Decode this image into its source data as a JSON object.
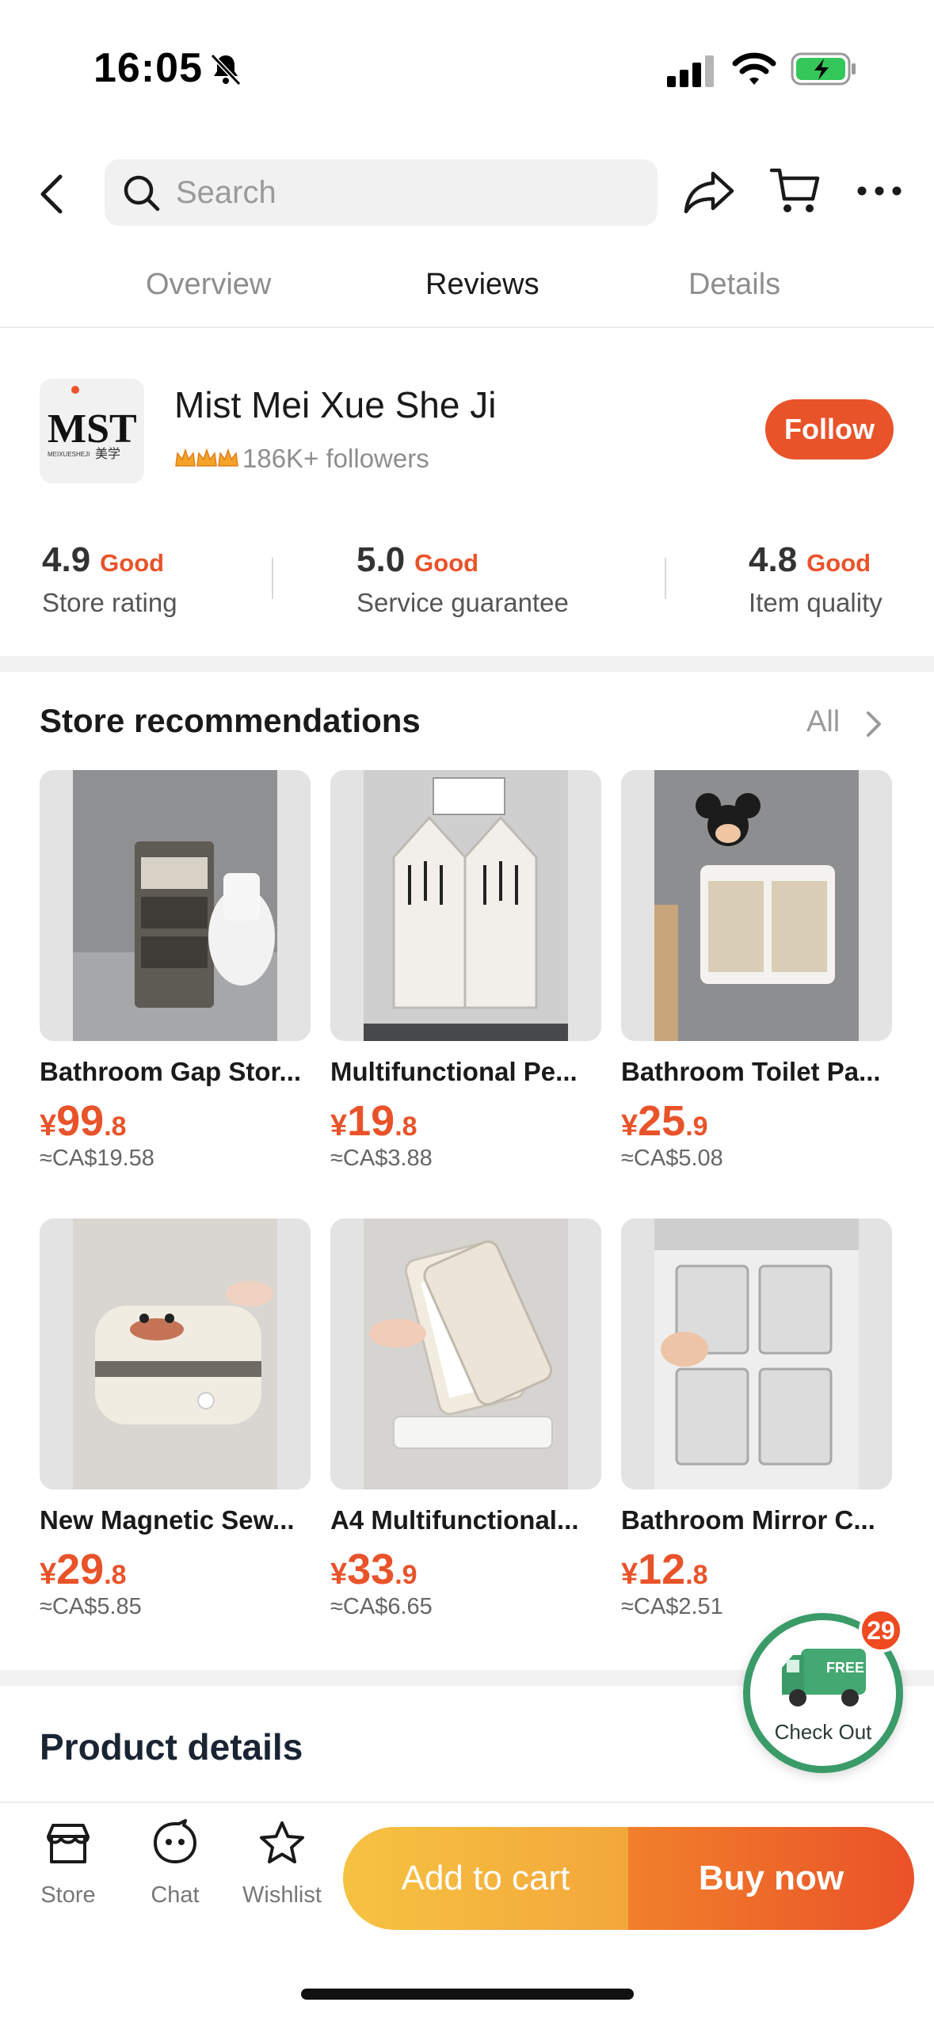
{
  "status_bar": {
    "time": "16:05"
  },
  "search": {
    "placeholder": "Search"
  },
  "tabs": [
    {
      "label": "Overview",
      "active": false
    },
    {
      "label": "Reviews",
      "active": true
    },
    {
      "label": "Details",
      "active": false
    }
  ],
  "store": {
    "name": "Mist Mei Xue She Ji",
    "followers": "186K+ followers",
    "follow_label": "Follow",
    "logo_text": "MST",
    "logo_sub": "美学",
    "logo_small": "MEIXUESHEJI",
    "ratings": [
      {
        "value": "4.9",
        "badge": "Good",
        "label": "Store rating"
      },
      {
        "value": "5.0",
        "badge": "Good",
        "label": "Service guarantee"
      },
      {
        "value": "4.8",
        "badge": "Good",
        "label": "Item quality"
      }
    ]
  },
  "recommendations": {
    "title": "Store recommendations",
    "all_label": "All",
    "products": [
      {
        "name": "Bathroom Gap Stor...",
        "price_symbol": "¥",
        "price_int": "99",
        "price_dec": ".8",
        "cad": "≈CA$19.58"
      },
      {
        "name": "Multifunctional Pe...",
        "price_symbol": "¥",
        "price_int": "19",
        "price_dec": ".8",
        "cad": "≈CA$3.88"
      },
      {
        "name": "Bathroom Toilet Pa...",
        "price_symbol": "¥",
        "price_int": "25",
        "price_dec": ".9",
        "cad": "≈CA$5.08"
      },
      {
        "name": "New Magnetic Sew...",
        "price_symbol": "¥",
        "price_int": "29",
        "price_dec": ".8",
        "cad": "≈CA$5.85"
      },
      {
        "name": "A4 Multifunctional...",
        "price_symbol": "¥",
        "price_int": "33",
        "price_dec": ".9",
        "cad": "≈CA$6.65"
      },
      {
        "name": "Bathroom Mirror C...",
        "price_symbol": "¥",
        "price_int": "12",
        "price_dec": ".8",
        "cad": "≈CA$2.51"
      }
    ]
  },
  "product_details": {
    "title": "Product details"
  },
  "checkout": {
    "label": "Check Out",
    "free_tag": "FREE",
    "badge_count": "29"
  },
  "bottom_bar": {
    "store_label": "Store",
    "chat_label": "Chat",
    "wishlist_label": "Wishlist",
    "add_to_cart_label": "Add to cart",
    "buy_now_label": "Buy now"
  },
  "colors": {
    "accent": "#e9532a",
    "checkout_ring": "#3a9b68",
    "add_cart": "#f5b53f"
  }
}
